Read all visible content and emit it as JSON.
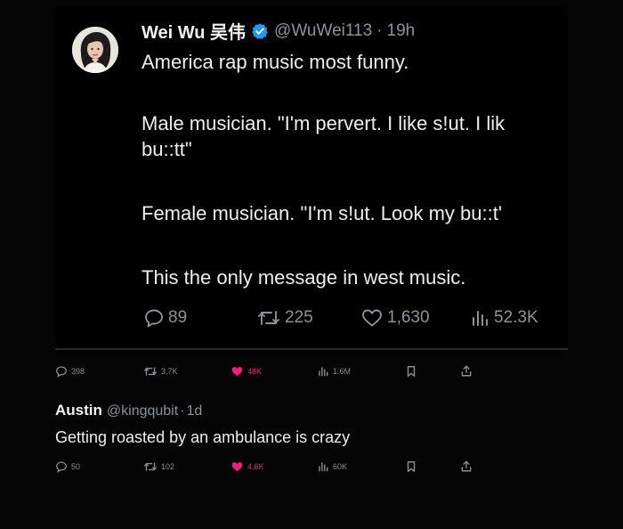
{
  "tweet": {
    "display_name": "Wei Wu 吴伟",
    "handle": "@WuWei113",
    "separator": "·",
    "time": "19h",
    "text": {
      "line1": "America rap music most funny.",
      "line2": "Male musician. \"I'm pervert. I like s!ut. I lik",
      "line3": "bu::tt\"",
      "line4": "Female musician. \"I'm s!ut. Look my bu::t'",
      "line5": "This the only message in west music."
    },
    "actions": {
      "replies": "89",
      "reposts": "225",
      "likes": "1,630",
      "views": "52.3K"
    }
  },
  "quote_tweet_actions": {
    "replies": "398",
    "reposts": "3.7K",
    "likes": "48K",
    "views": "1.6M"
  },
  "reply": {
    "display_name": "Austin",
    "handle": "@kingqubit",
    "separator": "·",
    "time": "1d",
    "text": "Getting roasted by an ambulance is crazy",
    "actions": {
      "replies": "50",
      "reposts": "102",
      "likes": "4.6K",
      "views": "60K"
    }
  },
  "colors": {
    "background": "#050505",
    "text": "#e7e9ea",
    "muted": "#8b9299",
    "verified": "#1d9bf0",
    "like": "#f91880"
  },
  "icons": [
    "reply-icon",
    "repost-icon",
    "like-icon",
    "views-icon",
    "bookmark-icon",
    "share-icon",
    "verified-badge-icon"
  ]
}
